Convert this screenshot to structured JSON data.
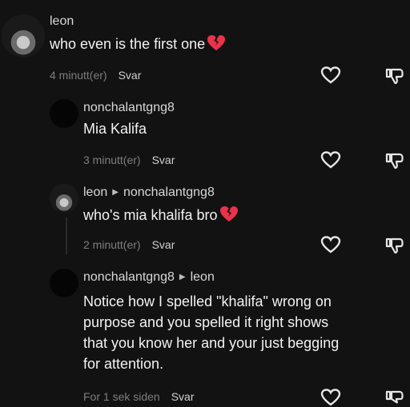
{
  "comments": [
    {
      "username": "leon",
      "reply_to": "",
      "text": "who even is the first one",
      "emoji": "broken-heart",
      "time": "4 minutt(er)",
      "reply_label": "Svar"
    },
    {
      "username": "nonchalantgng8",
      "reply_to": "",
      "text": "Mia Kalifa",
      "emoji": "",
      "time": "3 minutt(er)",
      "reply_label": "Svar"
    },
    {
      "username": "leon",
      "reply_to": "nonchalantgng8",
      "text": "who's mia khalifa bro",
      "emoji": "broken-heart",
      "time": "2 minutt(er)",
      "reply_label": "Svar"
    },
    {
      "username": "nonchalantgng8",
      "reply_to": "leon",
      "text_lines": [
        "Notice how I spelled \"khalifa\" wrong on",
        "purpose and you spelled it right shows",
        "that you know her and your just begging",
        "for attention."
      ],
      "emoji": "",
      "time": "For 1 sek siden",
      "reply_label": "Svar"
    }
  ],
  "icons": {
    "like": "heart-outline-icon",
    "dislike": "thumbs-down-icon",
    "emoji": "broken-heart-emoji"
  },
  "colors": {
    "background": "#121212",
    "broken_heart": "#e8334a"
  }
}
